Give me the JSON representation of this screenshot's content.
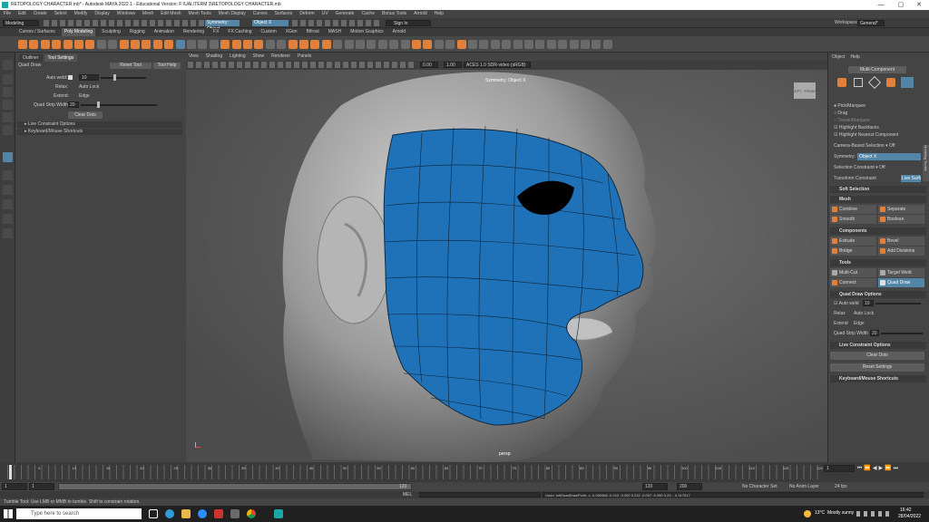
{
  "window": {
    "title": "RETOPOLOGY CHARACTER.mb* - Autodesk MAYA 2022.1 - Educational Version: F:\\UAL\\TERM 3\\RETOPOLOGY CHARACTER.mb",
    "minimize": "—",
    "maximize": "▢",
    "close": "✕"
  },
  "menubar": [
    "File",
    "Edit",
    "Create",
    "Select",
    "Modify",
    "Display",
    "Windows",
    "Mesh",
    "Edit Mesh",
    "Mesh Tools",
    "Mesh Display",
    "Curves",
    "Surfaces",
    "Deform",
    "UV",
    "Generate",
    "Cache",
    "Bonus Tools",
    "Arnold",
    "Help"
  ],
  "statusline": {
    "mode": "Modeling",
    "symmetry_field": "Object X",
    "signin": "Sign In",
    "workspace_label": "Workspace:",
    "workspace_value": "General*"
  },
  "shelf_tabs": [
    "Curves / Surfaces",
    "Poly Modeling",
    "Sculpting",
    "Rigging",
    "Animation",
    "Rendering",
    "FX",
    "FX Caching",
    "Custom",
    "XGen",
    "Bifrost",
    "MASH",
    "Motion Graphics",
    "Arnold"
  ],
  "shelf_active": "Poly Modeling",
  "left_panel": {
    "tabs": [
      "Outliner",
      "Tool Settings"
    ],
    "tool_name": "Quad Draw",
    "reset_tool": "Reset Tool",
    "tool_help": "Tool Help",
    "auto_weld_label": "Auto weld:",
    "auto_weld_value": "10",
    "relax_label": "Relax:",
    "relax_value": "Auto Lock",
    "extend_label": "Extend:",
    "extend_value": "Edge",
    "quad_strip_label": "Quad Strip Width:",
    "quad_strip_value": "20",
    "clear_dots": "Clear Dots",
    "section1": "Live Constraint Options",
    "section2": "Keyboard/Mouse Shortcuts"
  },
  "viewport": {
    "menu": [
      "View",
      "Shading",
      "Lighting",
      "Show",
      "Renderer",
      "Panels"
    ],
    "value1": "0.00",
    "value2": "1.00",
    "colorspace": "ACES 1.0 SDR-video (sRGB)",
    "symmetry_label": "Symmetry: Object X",
    "camera_label": "persp",
    "viewcube_left": "LEFT",
    "viewcube_front": "FRONT"
  },
  "right_panel": {
    "tabs": [
      "Object",
      "Help"
    ],
    "multi_component": "Multi-Component",
    "pick_marquee": "Pick/Marquee",
    "drag": "Drag",
    "tweak_marquee": "Tweak/Marquee",
    "highlight_backfaces": "Highlight Backfaces",
    "highlight_nearest": "Highlight Nearest Component",
    "camera_sel_label": "Camera-Based Selection",
    "camera_sel_value": "Off",
    "symmetry_label": "Symmetry:",
    "symmetry_value": "Object X",
    "sel_constraint_label": "Selection Constraint",
    "sel_constraint_value": "Off",
    "transform_constraint_label": "Transform Constraint",
    "transform_constraint_value": "Live Surface",
    "soft_selection": "Soft Selection",
    "mesh": "Mesh",
    "combine": "Combine",
    "separate": "Separate",
    "smooth": "Smooth",
    "boolean": "Boolean",
    "components": "Components",
    "extrude": "Extrude",
    "bevel": "Bevel",
    "bridge": "Bridge",
    "add_divisions": "Add Divisions",
    "tools": "Tools",
    "multi_cut": "Multi-Cut",
    "target_weld": "Target Weld",
    "connect": "Connect",
    "quad_draw": "Quad Draw",
    "quad_draw_options": "Quad Draw Options",
    "auto_weld": "Auto weld",
    "auto_weld_value": "10",
    "relax": "Relax",
    "relax_value": "Auto Lock",
    "extend": "Extend",
    "extend_value": "Edge",
    "quad_strip_width": "Quad Strip Width",
    "quad_strip_value": "20",
    "live_constraint": "Live Constraint Options",
    "clear_dots": "Clear Dots",
    "reset_settings": "Reset Settings",
    "keyboard_shortcuts": "Keyboard/Mouse Shortcuts",
    "side_tab": "Modeling Toolkit"
  },
  "timeslider": {
    "ticks": [
      "5",
      "10",
      "15",
      "20",
      "25",
      "30",
      "35",
      "40",
      "45",
      "50",
      "55",
      "60",
      "65",
      "70",
      "75",
      "80",
      "85",
      "90",
      "95",
      "100",
      "105",
      "110",
      "115",
      "120"
    ],
    "current_frame": "1",
    "end_frame": "5"
  },
  "range": {
    "start": "1",
    "start2": "1",
    "range_end": "120",
    "end1": "120",
    "end2": "200",
    "character_set": "No Character Set",
    "anim_layer": "No Anim Layer",
    "fps": "24 fps"
  },
  "cmdline": {
    "lang": "MEL",
    "result": "Undo: initQuadDrawPoint -x -0.052566 -0.213 -0.200 0.232 -0.007 -0.280 0.23... 0.317517"
  },
  "helpline": "Tumble Tool: Use LMB or MMB to tumble. Shift to constrain rotation.",
  "taskbar": {
    "search": "Type here to search",
    "weather_temp": "13°C",
    "weather_desc": "Mostly sunny",
    "time": "16:42",
    "date": "28/04/2022"
  },
  "colors": {
    "mesh_blue": "#1f72b8",
    "accent_orange": "#e0803a",
    "active_blue": "#5285a6"
  }
}
